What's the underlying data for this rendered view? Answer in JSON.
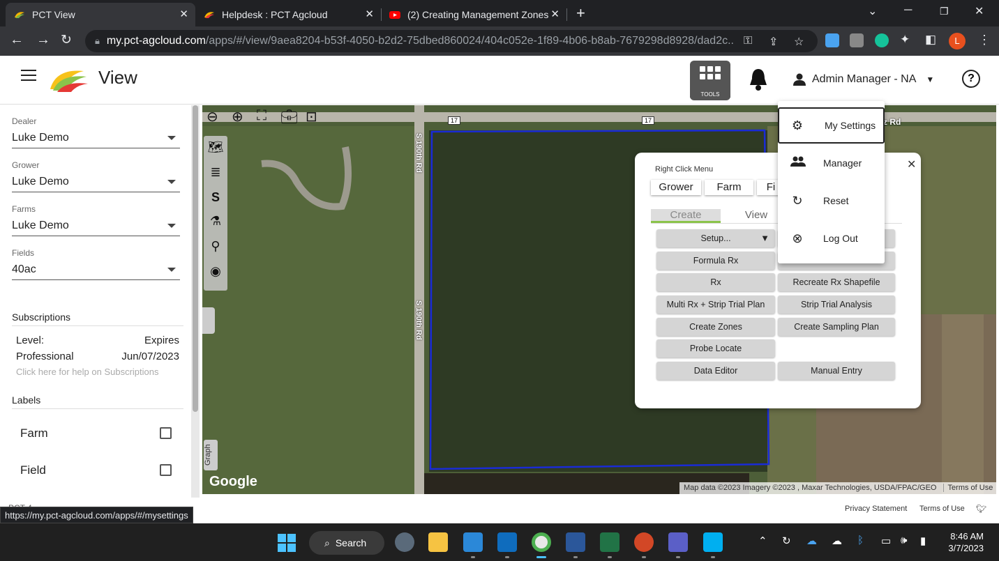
{
  "browser": {
    "tabs": [
      {
        "title": "PCT View",
        "active": true
      },
      {
        "title": "Helpdesk : PCT Agcloud",
        "active": false
      },
      {
        "title": "(2) Creating Management Zones",
        "active": false
      }
    ],
    "url_host": "my.pct-agcloud.com",
    "url_rest": "/apps/#/view/9aea8204-b53f-4050-b2d2-75dbed860024/404c052e-1f89-4b06-b8ab-7679298d8928/dad2c...",
    "profile_initial": "L",
    "status_url": "https://my.pct-agcloud.com/apps/#/mysettings"
  },
  "header": {
    "title": "View",
    "tools_label": "TOOLS",
    "user_name": "Admin Manager - NA"
  },
  "sidebar": {
    "dealer": {
      "label": "Dealer",
      "value": "Luke Demo"
    },
    "grower": {
      "label": "Grower",
      "value": "Luke Demo"
    },
    "farms": {
      "label": "Farms",
      "value": "Luke Demo"
    },
    "fields": {
      "label": "Fields",
      "value": "40ac"
    },
    "subscriptions": {
      "heading": "Subscriptions",
      "level_label": "Level:",
      "expires_label": "Expires",
      "level_value": "Professional",
      "expires_value": "Jun/07/2023",
      "help": "Click here for help on Subscriptions"
    },
    "labels": {
      "heading": "Labels",
      "farm": "Farm",
      "field": "Field"
    }
  },
  "map": {
    "road_vertical": "S 190th Rd",
    "road_vertical_2": "S 190th Rd",
    "road_top_right": "tz Rd",
    "shield_1": "17",
    "shield_2": "17",
    "google": "Google",
    "graph_tab": "Graph",
    "attribution": "Map data ©2023 Imagery ©2023 , Maxar Technologies, USDA/FPAC/GEO",
    "terms": "Terms of Use",
    "field_boundary_color": "#1a2bd6"
  },
  "right_click_menu": {
    "title": "Right Click Menu",
    "top_tabs": [
      "Grower",
      "Farm",
      "Fi"
    ],
    "mode_tabs": {
      "create": "Create",
      "view": "View"
    },
    "buttons": {
      "setup": "Setup...",
      "formula_rx": "Formula Rx",
      "rx": "Rx",
      "recreate_rx": "Recreate Rx Shapefile",
      "multi_rx": "Multi Rx + Strip Trial Plan",
      "strip_trial": "Strip Trial Analysis",
      "create_zones": "Create Zones",
      "create_sampling": "Create Sampling Plan",
      "probe_locate": "Probe Locate",
      "data_editor": "Data Editor",
      "manual_entry": "Manual Entry"
    }
  },
  "user_menu": {
    "items": [
      "My Settings",
      "Manager",
      "Reset",
      "Log Out"
    ]
  },
  "footer": {
    "pct": "PCT 4 ...",
    "privacy": "Privacy Statement",
    "terms": "Terms of Use"
  },
  "taskbar": {
    "search": "Search",
    "time": "8:46 AM",
    "date": "3/7/2023"
  }
}
